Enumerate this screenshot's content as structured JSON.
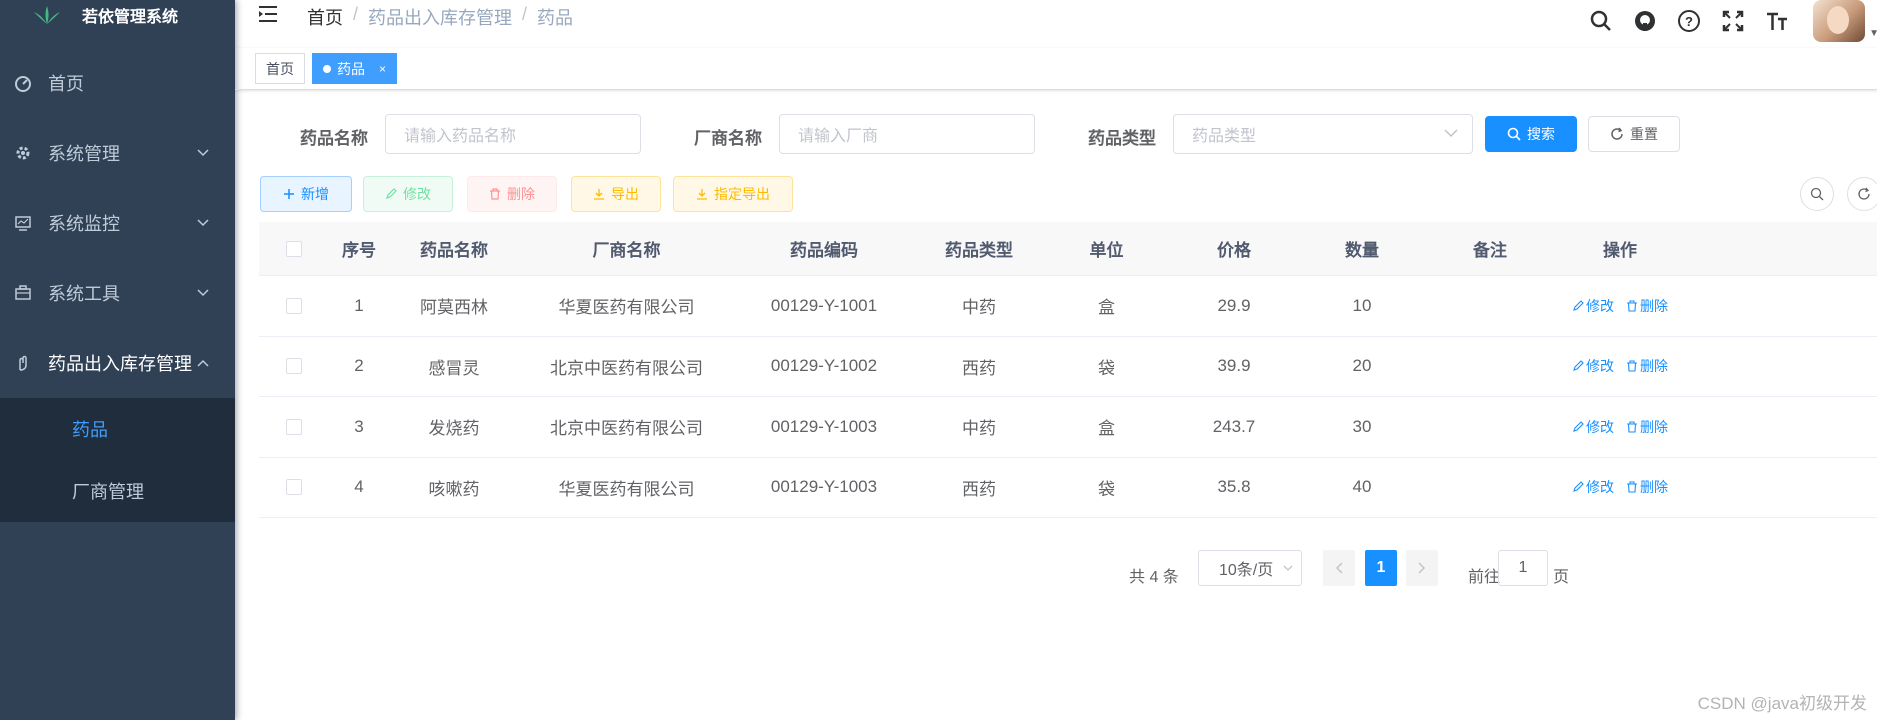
{
  "app": {
    "title": "若依管理系统"
  },
  "sidebar": {
    "items": [
      {
        "label": "首页"
      },
      {
        "label": "系统管理"
      },
      {
        "label": "系统监控"
      },
      {
        "label": "系统工具"
      },
      {
        "label": "药品出入库存管理"
      }
    ],
    "submenu": [
      {
        "label": "药品"
      },
      {
        "label": "厂商管理"
      }
    ]
  },
  "breadcrumb": [
    "首页",
    "药品出入库存管理",
    "药品"
  ],
  "tags": [
    {
      "label": "首页"
    },
    {
      "label": "药品",
      "close": "×"
    }
  ],
  "search": {
    "name_label": "药品名称",
    "name_placeholder": "请输入药品名称",
    "vendor_label": "厂商名称",
    "vendor_placeholder": "请输入厂商",
    "type_label": "药品类型",
    "type_placeholder": "药品类型",
    "search_btn": "搜索",
    "reset_btn": "重置"
  },
  "toolbar": {
    "add": "新增",
    "edit": "修改",
    "delete": "删除",
    "export": "导出",
    "export_selected": "指定导出"
  },
  "table": {
    "columns": [
      "序号",
      "药品名称",
      "厂商名称",
      "药品编码",
      "药品类型",
      "单位",
      "价格",
      "数量",
      "备注",
      "操作"
    ],
    "rows": [
      [
        "1",
        "阿莫西林",
        "华夏医药有限公司",
        "00129-Y-1001",
        "中药",
        "盒",
        "29.9",
        "10",
        ""
      ],
      [
        "2",
        "感冒灵",
        "北京中医药有限公司",
        "00129-Y-1002",
        "西药",
        "袋",
        "39.9",
        "20",
        ""
      ],
      [
        "3",
        "发烧药",
        "北京中医药有限公司",
        "00129-Y-1003",
        "中药",
        "盒",
        "243.7",
        "30",
        ""
      ],
      [
        "4",
        "咳嗽药",
        "华夏医药有限公司",
        "00129-Y-1003",
        "西药",
        "袋",
        "35.8",
        "40",
        ""
      ]
    ],
    "op_edit": "修改",
    "op_delete": "删除"
  },
  "pagination": {
    "total": "共 4 条",
    "page_size": "10条/页",
    "current": "1",
    "goto_label": "前往",
    "goto_value": "1",
    "page_suffix": "页"
  },
  "watermark": "CSDN @java初级开发",
  "colors": {
    "sidebar": "#304156",
    "primary": "#1890ff",
    "active_menu": "#409eff"
  }
}
